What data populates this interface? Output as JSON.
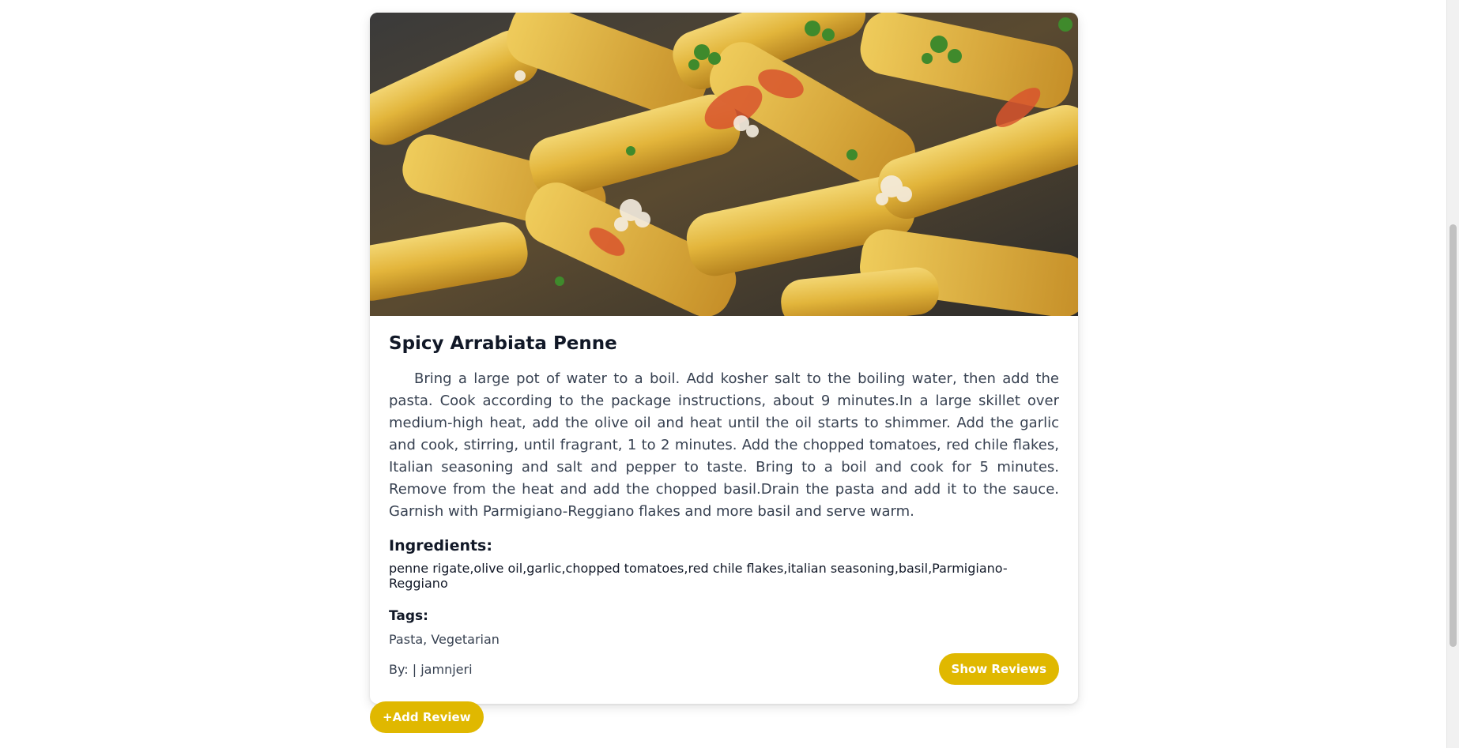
{
  "recipe": {
    "image_alt": "Penne pasta with tomato, parsley and grated Parmigiano",
    "title": "Spicy Arrabiata Penne",
    "instructions": "Bring a large pot of water to a boil. Add kosher salt to the boiling water, then add the pasta. Cook according to the package instructions, about 9 minutes.In a large skillet over medium-high heat, add the olive oil and heat until the oil starts to shimmer. Add the garlic and cook, stirring, until fragrant, 1 to 2 minutes. Add the chopped tomatoes, red chile flakes, Italian seasoning and salt and pepper to taste. Bring to a boil and cook for 5 minutes. Remove from the heat and add the chopped basil.Drain the pasta and add it to the sauce. Garnish with Parmigiano-Reggiano flakes and more basil and serve warm.",
    "ingredients_heading": "Ingredients:",
    "ingredients": "penne rigate,olive oil,garlic,chopped tomatoes,red chile flakes,italian seasoning,basil,Parmigiano-Reggiano",
    "tags_heading": "Tags:",
    "tags": "Pasta, Vegetarian",
    "author": "By: | jamnjeri"
  },
  "actions": {
    "show_reviews_label": "Show Reviews",
    "add_review_label": "+Add Review"
  },
  "colors": {
    "accent": "#e0b800",
    "text": "#111827",
    "muted_text": "#374151"
  }
}
